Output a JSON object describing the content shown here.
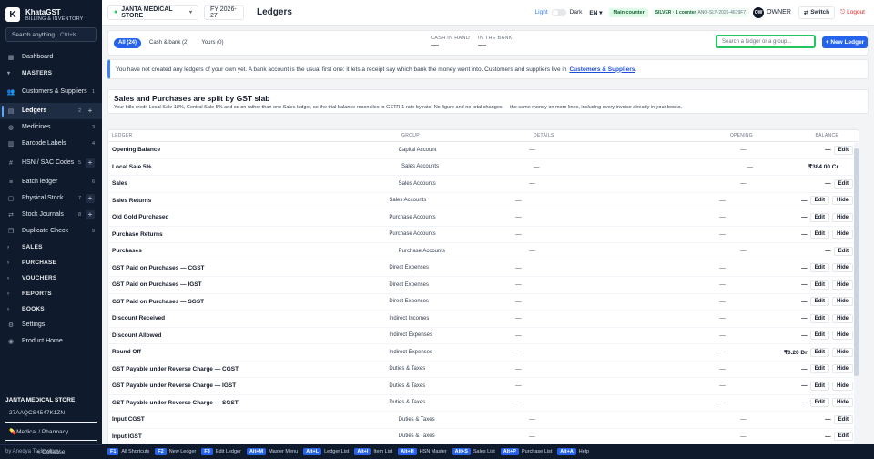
{
  "app": {
    "name": "KhataGST",
    "subtitle": "BILLING & INVENTORY",
    "logo": "K"
  },
  "sidebar": {
    "search": {
      "placeholder": "Search anything",
      "shortcut": "Ctrl+K"
    },
    "items": [
      {
        "kind": "item",
        "label": "Dashboard",
        "icon": "grid-icon",
        "count": "",
        "plus": false
      },
      {
        "kind": "group",
        "label": "MASTERS",
        "open": true
      },
      {
        "kind": "item",
        "label": "Customers & Suppliers",
        "icon": "users-icon",
        "count": "1",
        "plus": false,
        "tall": true
      },
      {
        "kind": "item",
        "label": "Ledgers",
        "icon": "book-icon",
        "count": "2",
        "plus": true,
        "active": true
      },
      {
        "kind": "item",
        "label": "Medicines",
        "icon": "pill-icon",
        "count": "3",
        "plus": false
      },
      {
        "kind": "item",
        "label": "Barcode Labels",
        "icon": "barcode-icon",
        "count": "4",
        "plus": false
      },
      {
        "kind": "item",
        "label": "HSN / SAC Codes",
        "icon": "hash-icon",
        "count": "5",
        "plus": true,
        "tall": true
      },
      {
        "kind": "item",
        "label": "Batch ledger",
        "icon": "layers-icon",
        "count": "6",
        "plus": false
      },
      {
        "kind": "item",
        "label": "Physical Stock",
        "icon": "box-icon",
        "count": "7",
        "plus": true
      },
      {
        "kind": "item",
        "label": "Stock Journals",
        "icon": "swap-icon",
        "count": "8",
        "plus": true
      },
      {
        "kind": "item",
        "label": "Duplicate Check",
        "icon": "copy-icon",
        "count": "9",
        "plus": false
      },
      {
        "kind": "group",
        "label": "SALES",
        "open": false
      },
      {
        "kind": "group",
        "label": "PURCHASE",
        "open": false
      },
      {
        "kind": "group",
        "label": "VOUCHERS",
        "open": false
      },
      {
        "kind": "group",
        "label": "REPORTS",
        "open": false
      },
      {
        "kind": "group",
        "label": "BOOKS",
        "open": false
      },
      {
        "kind": "item",
        "label": "Settings",
        "icon": "gear-icon",
        "count": "",
        "plus": false
      },
      {
        "kind": "item",
        "label": "Product Home",
        "icon": "person-icon",
        "count": "",
        "plus": false
      }
    ],
    "footer": {
      "store": "JANTA MEDICAL STORE",
      "gstin": "27AAQCS4547K1ZN",
      "type": "Medical / Pharmacy",
      "by": "by Anedya Technology",
      "collapse": "« Collapse"
    }
  },
  "topbar": {
    "store": "JANTA MEDICAL STORE",
    "fy": "FY 2026-27",
    "page_title": "Ledgers",
    "theme_light": "Light",
    "theme_dark": "Dark",
    "lang": "EN",
    "counter": "Main counter",
    "license": "SILVER · 1 counter",
    "license_key": "ANO-SLV-2026-4679F7",
    "owner_initials": "OW",
    "owner": "OWNER",
    "switch": "Switch",
    "logout": "Logout"
  },
  "filters": {
    "tabs": [
      "All (24)",
      "Cash & bank (2)",
      "Yours (0)"
    ],
    "active": 0
  },
  "balances": {
    "cash_label": "CASH IN HAND",
    "cash_value": "—",
    "bank_label": "IN THE BANK",
    "bank_value": "—"
  },
  "ledger_search": {
    "placeholder": "Search a ledger or a group..."
  },
  "new_button": "+ New Ledger",
  "info": {
    "text": "You have not created any ledgers of your own yet. A bank account is the usual first one: it lets a receipt say which bank the money went into. Customers and suppliers live in",
    "link": "Customers & Suppliers"
  },
  "gst_notice": {
    "title": "Sales and Purchases are split by GST slab",
    "desc": "Your bills credit Local Sale 18%, Central Sale 5% and so on rather than one Sales ledger, so the trial balance reconciles to GSTR-1 rate by rate. No figure and no total changes — the same money on more lines, including every invoice already in your books."
  },
  "table": {
    "columns": [
      "LEDGER",
      "GROUP",
      "DETAILS",
      "OPENING",
      "BALANCE"
    ],
    "rows": [
      {
        "ledger": "Opening Balance",
        "group": "Capital Account",
        "details": "—",
        "opening": "—",
        "balance": "—",
        "actions": [
          "Edit"
        ]
      },
      {
        "ledger": "Local Sale 5%",
        "group": "Sales Accounts",
        "details": "—",
        "opening": "—",
        "balance": "₹384.00 Cr",
        "actions": []
      },
      {
        "ledger": "Sales",
        "group": "Sales Accounts",
        "details": "—",
        "opening": "—",
        "balance": "—",
        "actions": [
          "Edit"
        ]
      },
      {
        "ledger": "Sales Returns",
        "group": "Sales Accounts",
        "details": "—",
        "opening": "—",
        "balance": "—",
        "actions": [
          "Edit",
          "Hide"
        ]
      },
      {
        "ledger": "Old Gold Purchased",
        "group": "Purchase Accounts",
        "details": "—",
        "opening": "—",
        "balance": "—",
        "actions": [
          "Edit",
          "Hide"
        ]
      },
      {
        "ledger": "Purchase Returns",
        "group": "Purchase Accounts",
        "details": "—",
        "opening": "—",
        "balance": "—",
        "actions": [
          "Edit",
          "Hide"
        ]
      },
      {
        "ledger": "Purchases",
        "group": "Purchase Accounts",
        "details": "—",
        "opening": "—",
        "balance": "—",
        "actions": [
          "Edit"
        ]
      },
      {
        "ledger": "GST Paid on Purchases — CGST",
        "group": "Direct Expenses",
        "details": "—",
        "opening": "—",
        "balance": "—",
        "actions": [
          "Edit",
          "Hide"
        ]
      },
      {
        "ledger": "GST Paid on Purchases — IGST",
        "group": "Direct Expenses",
        "details": "—",
        "opening": "—",
        "balance": "—",
        "actions": [
          "Edit",
          "Hide"
        ]
      },
      {
        "ledger": "GST Paid on Purchases — SGST",
        "group": "Direct Expenses",
        "details": "—",
        "opening": "—",
        "balance": "—",
        "actions": [
          "Edit",
          "Hide"
        ]
      },
      {
        "ledger": "Discount Received",
        "group": "Indirect Incomes",
        "details": "—",
        "opening": "—",
        "balance": "—",
        "actions": [
          "Edit",
          "Hide"
        ]
      },
      {
        "ledger": "Discount Allowed",
        "group": "Indirect Expenses",
        "details": "—",
        "opening": "—",
        "balance": "—",
        "actions": [
          "Edit",
          "Hide"
        ]
      },
      {
        "ledger": "Round Off",
        "group": "Indirect Expenses",
        "details": "—",
        "opening": "—",
        "balance": "₹0.20 Dr",
        "actions": [
          "Edit",
          "Hide"
        ]
      },
      {
        "ledger": "GST Payable under Reverse Charge — CGST",
        "group": "Duties & Taxes",
        "details": "—",
        "opening": "—",
        "balance": "—",
        "actions": [
          "Edit",
          "Hide"
        ]
      },
      {
        "ledger": "GST Payable under Reverse Charge — IGST",
        "group": "Duties & Taxes",
        "details": "—",
        "opening": "—",
        "balance": "—",
        "actions": [
          "Edit",
          "Hide"
        ]
      },
      {
        "ledger": "GST Payable under Reverse Charge — SGST",
        "group": "Duties & Taxes",
        "details": "—",
        "opening": "—",
        "balance": "—",
        "actions": [
          "Edit",
          "Hide"
        ]
      },
      {
        "ledger": "Input CGST",
        "group": "Duties & Taxes",
        "details": "—",
        "opening": "—",
        "balance": "—",
        "actions": [
          "Edit"
        ]
      },
      {
        "ledger": "Input IGST",
        "group": "Duties & Taxes",
        "details": "—",
        "opening": "—",
        "balance": "—",
        "actions": [
          "Edit"
        ]
      }
    ]
  },
  "shortcuts": [
    {
      "key": "F1",
      "label": "All Shortcuts"
    },
    {
      "key": "F2",
      "label": "New Ledger"
    },
    {
      "key": "F3",
      "label": "Edit Ledger"
    },
    {
      "key": "Alt+M",
      "label": "Master Menu"
    },
    {
      "key": "Alt+L",
      "label": "Ledger List"
    },
    {
      "key": "Alt+I",
      "label": "Item List"
    },
    {
      "key": "Alt+H",
      "label": "HSN Master"
    },
    {
      "key": "Alt+S",
      "label": "Sales List"
    },
    {
      "key": "Alt+P",
      "label": "Purchase List"
    },
    {
      "key": "Alt+A",
      "label": "Help"
    }
  ]
}
